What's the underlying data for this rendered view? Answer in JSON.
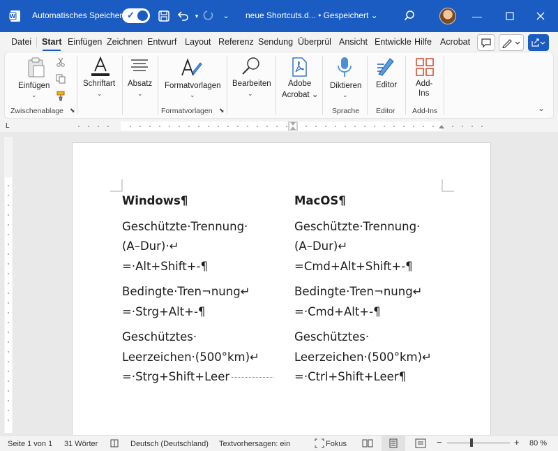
{
  "titlebar": {
    "autosave_label": "Automatisches Speichern",
    "doc_title": "neue Shortcuts.d...  •  Gespeichert",
    "title_caret": "⌄"
  },
  "tabs": [
    "Datei",
    "Start",
    "Einfügen",
    "Zeichnen",
    "Entwurf",
    "Layout",
    "Referenz",
    "Sendung",
    "Überprül",
    "Ansicht",
    "Entwickle",
    "Hilfe",
    "Acrobat"
  ],
  "ribbon": {
    "einfuegen": "Einfügen",
    "schriftart": "Schriftart",
    "absatz": "Absatz",
    "formatvorlagen": "Formatvorlagen",
    "bearbeiten": "Bearbeiten",
    "adobe_line1": "Adobe",
    "adobe_line2": "Acrobat",
    "diktieren": "Diktieren",
    "editor": "Editor",
    "addins_line1": "Add-",
    "addins_line2": "Ins",
    "groups": {
      "zwischenablage": "Zwischenablage",
      "formatvorlagen": "Formatvorlagen",
      "sprache": "Sprache",
      "editor": "Editor",
      "addins": "Add-Ins"
    }
  },
  "ruler_corner": "L",
  "document": {
    "left": {
      "heading": "Windows¶",
      "lines": [
        "Geschützte·Trennung·",
        "(A–Dur)·↵",
        "=·Alt+Shift+-¶",
        "Bedingte·Tren¬nung↵",
        "=·Strg+Alt+-¶",
        "Geschütztes·",
        "Leerzeichen·(500°km)↵",
        "=·Strg+Shift+Leer"
      ]
    },
    "right": {
      "heading": "MacOS¶",
      "lines": [
        "Geschützte·Trennung·",
        "(A–Dur)↵",
        "=Cmd+Alt+Shift+-¶",
        "Bedingte·Tren¬nung↵",
        "=·Cmd+Alt+-¶",
        "Geschütztes·",
        "Leerzeichen·(500°km)↵",
        "=·Ctrl+Shift+Leer¶"
      ]
    }
  },
  "statusbar": {
    "page": "Seite 1 von 1",
    "words": "31 Wörter",
    "language": "Deutsch (Deutschland)",
    "predictions": "Textvorhersagen: ein",
    "focus": "Fokus",
    "zoom_minus": "−",
    "zoom_plus": "+",
    "zoom": "80 %"
  },
  "colors": {
    "brand": "#1a5cc1"
  }
}
